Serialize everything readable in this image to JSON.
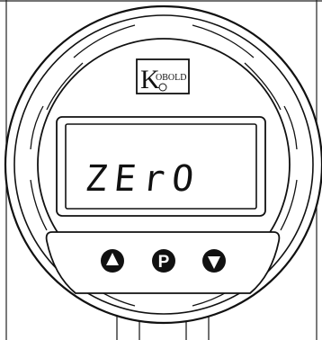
{
  "brand": {
    "name": "KOBOLD",
    "initial": "K",
    "rest": "OBOLD"
  },
  "display": {
    "text": "ZErO"
  },
  "buttons": {
    "up": {
      "icon": "triangle-up-icon"
    },
    "program": {
      "label": "P"
    },
    "down": {
      "icon": "triangle-down-icon"
    }
  },
  "colors": {
    "ink": "#111111",
    "paper": "#ffffff"
  }
}
